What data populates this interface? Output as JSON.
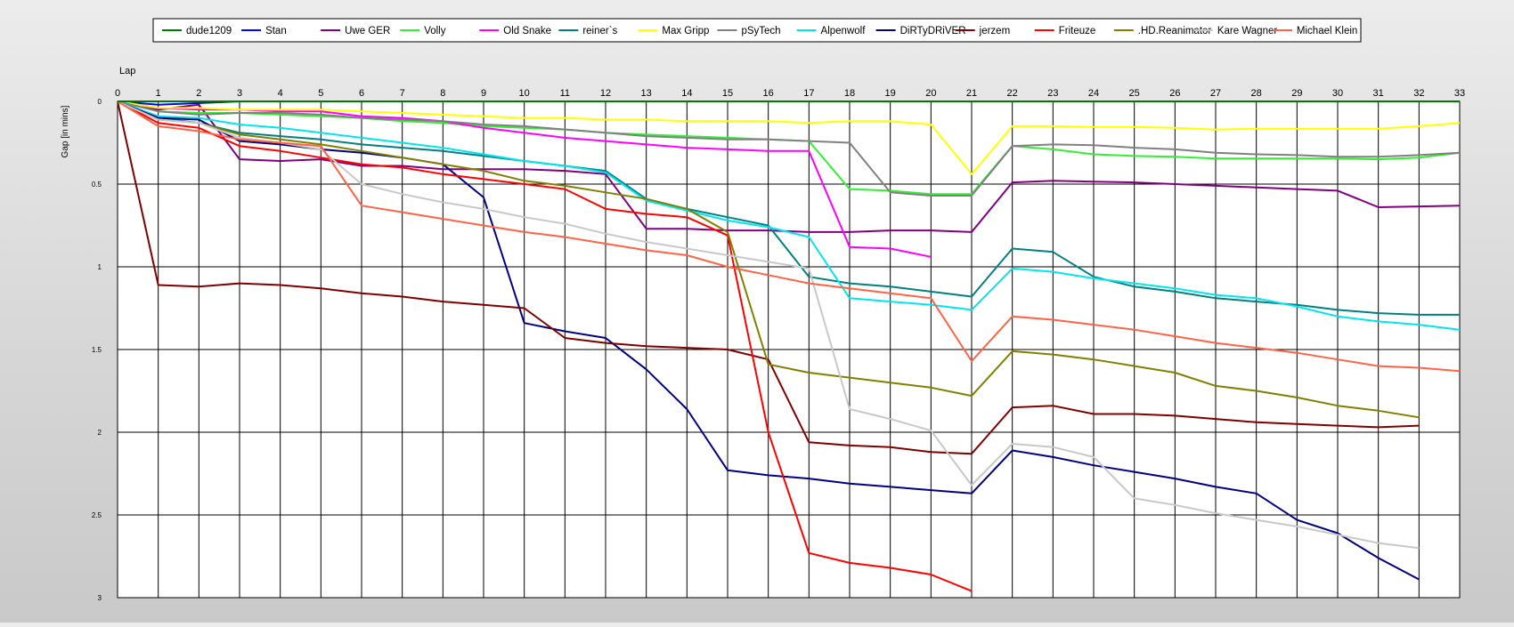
{
  "chart_data": {
    "type": "line",
    "xlabel": "Lap",
    "ylabel": "Gap [in mins]",
    "xlim": [
      0,
      33
    ],
    "ylim": [
      0,
      3
    ],
    "y_inverted": true,
    "grid": true,
    "legend_position": "top",
    "x_ticks": [
      "0",
      "1",
      "2",
      "3",
      "4",
      "5",
      "6",
      "7",
      "8",
      "9",
      "10",
      "11",
      "12",
      "13",
      "14",
      "15",
      "16",
      "17",
      "18",
      "19",
      "20",
      "21",
      "22",
      "23",
      "24",
      "25",
      "26",
      "27",
      "28",
      "29",
      "30",
      "31",
      "32",
      "33"
    ],
    "y_ticks": [
      "0",
      "0.5",
      "1",
      "1.5",
      "2",
      "2.5",
      "3"
    ],
    "series": [
      {
        "name": "dude1209",
        "color": "#007a00",
        "x": [
          0,
          33
        ],
        "y": [
          0,
          0
        ]
      },
      {
        "name": "Stan",
        "color": "#0000ff",
        "x": [
          0,
          1,
          2,
          3
        ],
        "y": [
          0,
          0.02,
          0.01,
          0
        ]
      },
      {
        "name": "Uwe GER",
        "color": "#800080",
        "x": [
          0,
          1,
          2,
          3,
          4,
          5,
          6,
          7,
          8,
          9,
          10,
          11,
          12,
          13,
          14,
          15,
          16,
          17,
          18,
          19,
          20,
          21,
          22,
          23,
          24,
          25,
          26,
          27,
          28,
          29,
          30,
          31,
          32,
          33
        ],
        "y": [
          0,
          0.05,
          0.02,
          0.35,
          0.36,
          0.35,
          0.39,
          0.39,
          0.41,
          0.41,
          0.41,
          0.42,
          0.44,
          0.77,
          0.77,
          0.78,
          0.78,
          0.79,
          0.79,
          0.78,
          0.78,
          0.79,
          0.49,
          0.48,
          0.485,
          0.49,
          0.5,
          0.51,
          0.52,
          0.53,
          0.54,
          0.64,
          0.635,
          0.63
        ]
      },
      {
        "name": "Volly",
        "color": "#33ee33",
        "x": [
          0,
          1,
          2,
          3,
          4,
          5,
          6,
          7,
          8,
          9,
          10,
          11,
          12,
          13,
          14,
          15,
          16,
          17,
          18,
          19,
          20,
          21,
          22,
          23,
          24,
          25,
          26,
          27,
          28,
          29,
          30,
          31,
          32,
          33
        ],
        "y": [
          0,
          0.06,
          0.07,
          0.07,
          0.08,
          0.09,
          0.1,
          0.12,
          0.13,
          0.15,
          0.16,
          0.17,
          0.19,
          0.2,
          0.21,
          0.22,
          0.23,
          0.24,
          0.53,
          0.54,
          0.56,
          0.56,
          0.27,
          0.29,
          0.32,
          0.33,
          0.335,
          0.345,
          0.345,
          0.345,
          0.345,
          0.35,
          0.34,
          0.31
        ]
      },
      {
        "name": "Old Snake",
        "color": "#ff00ff",
        "x": [
          0,
          1,
          2,
          3,
          4,
          5,
          6,
          7,
          8,
          9,
          10,
          11,
          12,
          13,
          14,
          15,
          16,
          17,
          18,
          19,
          20
        ],
        "y": [
          0,
          0.04,
          0.05,
          0.05,
          0.06,
          0.06,
          0.09,
          0.1,
          0.12,
          0.16,
          0.19,
          0.22,
          0.24,
          0.26,
          0.28,
          0.29,
          0.3,
          0.3,
          0.88,
          0.89,
          0.94
        ]
      },
      {
        "name": "reiner`s",
        "color": "#008080",
        "x": [
          0,
          1,
          2,
          3,
          4,
          5,
          6,
          7,
          8,
          9,
          10,
          11,
          12,
          13,
          14,
          15,
          16,
          17,
          18,
          19,
          20,
          21,
          22,
          23,
          24,
          25,
          26,
          27,
          28,
          29,
          30,
          31,
          32,
          33
        ],
        "y": [
          0,
          0.1,
          0.13,
          0.19,
          0.21,
          0.23,
          0.26,
          0.28,
          0.3,
          0.33,
          0.36,
          0.39,
          0.42,
          0.59,
          0.65,
          0.7,
          0.75,
          1.06,
          1.1,
          1.12,
          1.15,
          1.18,
          0.89,
          0.91,
          1.06,
          1.12,
          1.15,
          1.19,
          1.21,
          1.23,
          1.26,
          1.28,
          1.29,
          1.29
        ]
      },
      {
        "name": "Max Gripp",
        "color": "#ffff00",
        "x": [
          0,
          1,
          2,
          3,
          4,
          5,
          6,
          7,
          8,
          9,
          10,
          11,
          12,
          13,
          14,
          15,
          16,
          17,
          18,
          19,
          20,
          21,
          22,
          23,
          24,
          25,
          26,
          27,
          28,
          29,
          30,
          31,
          32,
          33
        ],
        "y": [
          0,
          0.04,
          0.04,
          0.05,
          0.05,
          0.05,
          0.06,
          0.07,
          0.08,
          0.09,
          0.1,
          0.1,
          0.11,
          0.11,
          0.12,
          0.12,
          0.12,
          0.13,
          0.12,
          0.12,
          0.14,
          0.44,
          0.15,
          0.15,
          0.155,
          0.155,
          0.16,
          0.17,
          0.165,
          0.165,
          0.165,
          0.165,
          0.15,
          0.13
        ]
      },
      {
        "name": "pSyTech",
        "color": "#808080",
        "x": [
          0,
          1,
          2,
          3,
          4,
          5,
          6,
          7,
          8,
          9,
          10,
          11,
          12,
          13,
          14,
          15,
          16,
          17,
          18,
          19,
          20,
          21,
          22,
          23,
          24,
          25,
          26,
          27,
          28,
          29,
          30,
          31,
          32,
          33
        ],
        "y": [
          0,
          0.06,
          0.08,
          0.07,
          0.07,
          0.08,
          0.1,
          0.11,
          0.12,
          0.14,
          0.15,
          0.17,
          0.19,
          0.21,
          0.22,
          0.23,
          0.23,
          0.24,
          0.25,
          0.55,
          0.57,
          0.57,
          0.27,
          0.26,
          0.265,
          0.28,
          0.29,
          0.31,
          0.32,
          0.325,
          0.335,
          0.335,
          0.325,
          0.31
        ]
      },
      {
        "name": "Alpenwolf",
        "color": "#00e5ee",
        "x": [
          0,
          1,
          2,
          3,
          4,
          5,
          6,
          7,
          8,
          9,
          10,
          11,
          12,
          13,
          14,
          15,
          16,
          17,
          18,
          19,
          20,
          21,
          22,
          23,
          24,
          25,
          26,
          27,
          28,
          29,
          30,
          31,
          32,
          33
        ],
        "y": [
          0,
          0.09,
          0.1,
          0.14,
          0.16,
          0.19,
          0.22,
          0.25,
          0.28,
          0.32,
          0.36,
          0.39,
          0.43,
          0.6,
          0.66,
          0.72,
          0.76,
          0.82,
          1.19,
          1.21,
          1.23,
          1.26,
          1.01,
          1.03,
          1.07,
          1.1,
          1.13,
          1.17,
          1.19,
          1.24,
          1.3,
          1.33,
          1.35,
          1.38
        ]
      },
      {
        "name": "DiRTyDRiVER",
        "color": "#000080",
        "x": [
          0,
          1,
          2,
          3,
          4,
          5,
          6,
          7,
          8,
          9,
          10,
          11,
          12,
          13,
          14,
          15,
          16,
          17,
          18,
          19,
          20,
          21,
          22,
          23,
          24,
          25,
          26,
          27,
          28,
          29,
          30,
          31,
          32
        ],
        "y": [
          0,
          0.1,
          0.11,
          0.24,
          0.26,
          0.29,
          0.31,
          0.34,
          0.38,
          0.58,
          1.34,
          1.39,
          1.43,
          1.62,
          1.86,
          2.23,
          2.26,
          2.28,
          2.31,
          2.33,
          2.35,
          2.37,
          2.11,
          2.15,
          2.2,
          2.24,
          2.28,
          2.33,
          2.37,
          2.53,
          2.61,
          2.76,
          2.89
        ]
      },
      {
        "name": "jerzem",
        "color": "#800000",
        "x": [
          0,
          1,
          2,
          3,
          4,
          5,
          6,
          7,
          8,
          9,
          10,
          11,
          12,
          13,
          14,
          15,
          16,
          17,
          18,
          19,
          20,
          21,
          22,
          23,
          24,
          25,
          26,
          27,
          28,
          29,
          30,
          31,
          32
        ],
        "y": [
          0,
          1.11,
          1.12,
          1.1,
          1.11,
          1.13,
          1.16,
          1.18,
          1.21,
          1.23,
          1.25,
          1.43,
          1.46,
          1.48,
          1.49,
          1.5,
          1.56,
          2.06,
          2.08,
          2.09,
          2.12,
          2.13,
          1.85,
          1.84,
          1.89,
          1.89,
          1.9,
          1.92,
          1.94,
          1.95,
          1.96,
          1.97,
          1.96
        ]
      },
      {
        "name": "Friteuze",
        "color": "#ff0000",
        "x": [
          0,
          1,
          2,
          3,
          4,
          5,
          6,
          7,
          8,
          9,
          10,
          11,
          12,
          13,
          14,
          15,
          16,
          17,
          18,
          19,
          20,
          21
        ],
        "y": [
          0,
          0.13,
          0.16,
          0.27,
          0.3,
          0.34,
          0.38,
          0.4,
          0.44,
          0.47,
          0.5,
          0.53,
          0.65,
          0.68,
          0.7,
          0.81,
          2.0,
          2.73,
          2.79,
          2.82,
          2.86,
          2.96
        ]
      },
      {
        "name": ".HD.Reanimator",
        "color": "#808000",
        "x": [
          0,
          1,
          2,
          3,
          4,
          5,
          6,
          7,
          8,
          9,
          10,
          11,
          12,
          13,
          14,
          15,
          16,
          17,
          18,
          19,
          20,
          21,
          22,
          23,
          24,
          25,
          26,
          27,
          28,
          29,
          30,
          31,
          32
        ],
        "y": [
          0,
          0.11,
          0.13,
          0.2,
          0.23,
          0.26,
          0.3,
          0.34,
          0.38,
          0.42,
          0.48,
          0.51,
          0.55,
          0.59,
          0.65,
          0.79,
          1.59,
          1.64,
          1.67,
          1.7,
          1.73,
          1.78,
          1.51,
          1.53,
          1.56,
          1.6,
          1.64,
          1.72,
          1.75,
          1.79,
          1.84,
          1.87,
          1.91
        ]
      },
      {
        "name": "Kare Wagner",
        "color": "#c8c8c8",
        "x": [
          0,
          1,
          2,
          3,
          4,
          5,
          6,
          7,
          8,
          9,
          10,
          11,
          12,
          13,
          14,
          15,
          16,
          17,
          18,
          19,
          20,
          21,
          22,
          23,
          24,
          25,
          26,
          27,
          28,
          29,
          30,
          31,
          32
        ],
        "y": [
          0,
          0.11,
          0.13,
          0.22,
          0.25,
          0.29,
          0.5,
          0.56,
          0.61,
          0.65,
          0.7,
          0.74,
          0.8,
          0.85,
          0.89,
          0.93,
          0.97,
          1.01,
          1.86,
          1.92,
          1.99,
          2.32,
          2.07,
          2.09,
          2.15,
          2.4,
          2.44,
          2.49,
          2.53,
          2.57,
          2.62,
          2.67,
          2.7
        ]
      },
      {
        "name": "Michael Klein",
        "color": "#ff6347",
        "x": [
          0,
          1,
          2,
          3,
          4,
          5,
          6,
          7,
          8,
          9,
          10,
          11,
          12,
          13,
          14,
          15,
          16,
          17,
          18,
          19,
          20,
          21,
          22,
          23,
          24,
          25,
          26,
          27,
          28,
          29,
          30,
          31,
          32,
          33
        ],
        "y": [
          0,
          0.15,
          0.18,
          0.23,
          0.25,
          0.27,
          0.63,
          0.67,
          0.71,
          0.75,
          0.79,
          0.82,
          0.86,
          0.9,
          0.93,
          1.0,
          1.05,
          1.1,
          1.13,
          1.16,
          1.19,
          1.57,
          1.3,
          1.32,
          1.35,
          1.38,
          1.42,
          1.46,
          1.49,
          1.52,
          1.56,
          1.6,
          1.61,
          1.63
        ]
      }
    ]
  }
}
